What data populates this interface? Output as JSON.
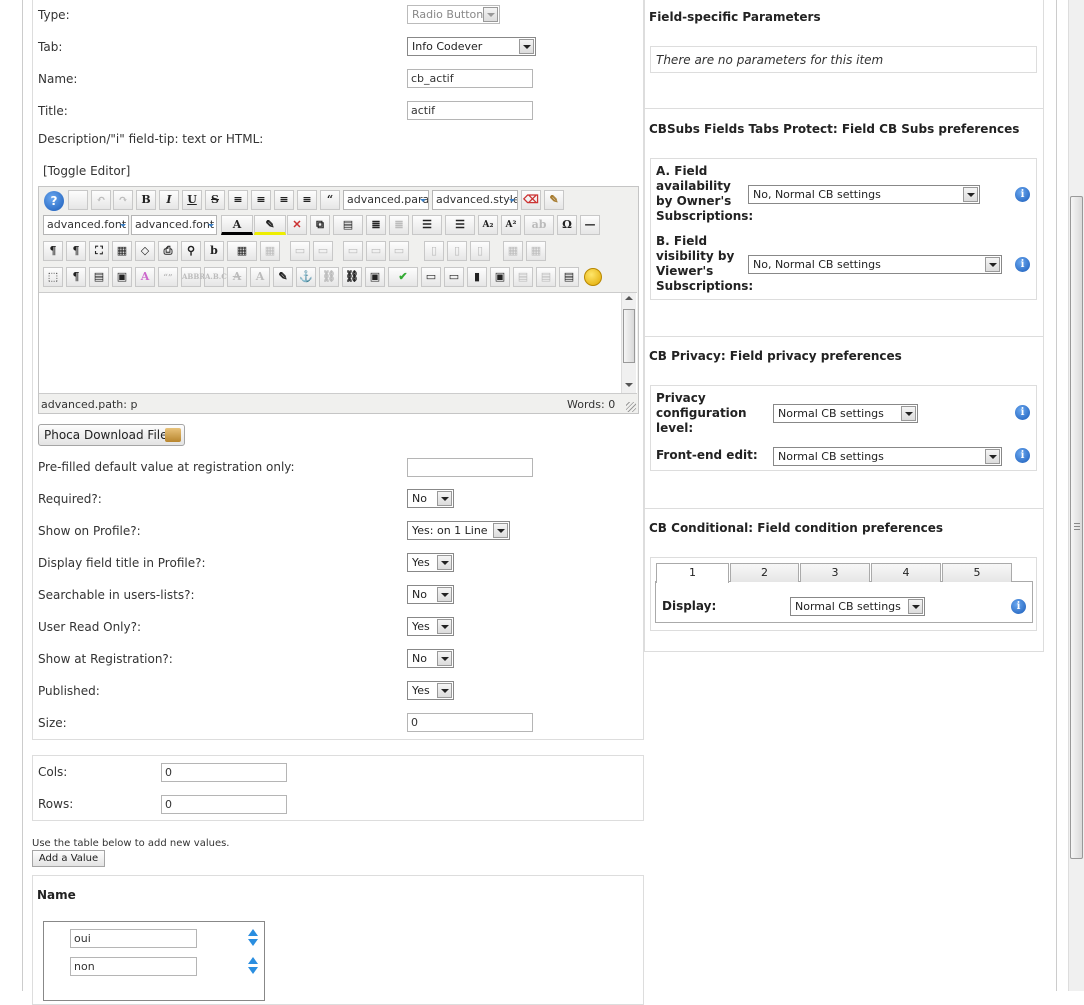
{
  "form": {
    "type_label": "Type:",
    "type_value": "Radio Buttons",
    "tab_label": "Tab:",
    "tab_value": "Info Codever",
    "name_label": "Name:",
    "name_value": "cb_actif",
    "title_label": "Title:",
    "title_value": "actif",
    "description_label": "Description/\"i\" field-tip: text or HTML:",
    "toggle_editor": "[Toggle Editor]",
    "prefilled_label": "Pre-filled default value at registration only:",
    "prefilled_value": "",
    "required_label": "Required?:",
    "required_value": "No",
    "show_profile_label": "Show on Profile?:",
    "show_profile_value": "Yes: on 1 Line",
    "display_title_label": "Display field title in Profile?:",
    "display_title_value": "Yes",
    "searchable_label": "Searchable in users-lists?:",
    "searchable_value": "No",
    "user_read_only_label": "User Read Only?:",
    "user_read_only_value": "Yes",
    "show_registration_label": "Show at Registration?:",
    "show_registration_value": "No",
    "published_label": "Published:",
    "published_value": "Yes",
    "size_label": "Size:",
    "size_value": "0"
  },
  "editor": {
    "paragraph_select": "advanced.para",
    "style_select": "advanced.style",
    "fontface_select": "advanced.font",
    "fontsize_select": "advanced.font",
    "path": "advanced.path: p",
    "words": "Words: 0",
    "phoca_button": "Phoca Download File"
  },
  "dims": {
    "cols_label": "Cols:",
    "cols_value": "0",
    "rows_label": "Rows:",
    "rows_value": "0"
  },
  "values_table": {
    "hint": "Use the table below to add new values.",
    "add_button": "Add a Value",
    "name_header": "Name",
    "rows": [
      "oui",
      "non"
    ]
  },
  "right": {
    "field_params_title": "Field-specific Parameters",
    "no_params": "There are no parameters for this item",
    "cbsubs_title": "CBSubs Fields Tabs Protect: Field CB Subs preferences",
    "field_avail_label": "A. Field availability by Owner's Subscriptions:",
    "field_avail_value": "No, Normal CB settings",
    "field_vis_label": "B. Field visibility by Viewer's Subscriptions:",
    "field_vis_value": "No, Normal CB settings",
    "privacy_title": "CB Privacy: Field privacy preferences",
    "privacy_level_label": "Privacy configuration level:",
    "privacy_level_value": "Normal CB settings",
    "frontend_edit_label": "Front-end edit:",
    "frontend_edit_value": "Normal CB settings",
    "conditional_title": "CB Conditional: Field condition preferences",
    "tabs": [
      "1",
      "2",
      "3",
      "4",
      "5"
    ],
    "display_label": "Display:",
    "display_value": "Normal CB settings"
  },
  "colors": {
    "info_icon": "#1a5bb8",
    "panel_border": "#dddddd"
  }
}
